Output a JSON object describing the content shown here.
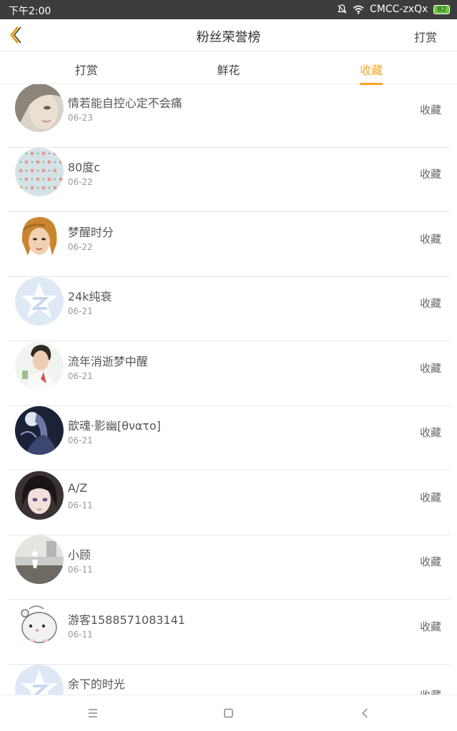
{
  "status": {
    "time": "下午2:00",
    "carrier": "CMCC-zxQx",
    "battery": "82"
  },
  "header": {
    "title": "粉丝荣誉榜",
    "action": "打赏"
  },
  "tabs": [
    {
      "label": "打赏",
      "active": false
    },
    {
      "label": "鲜花",
      "active": false
    },
    {
      "label": "收藏",
      "active": true
    }
  ],
  "accent_color": "#f5a623",
  "list": [
    {
      "name": "情若能自控心定不会痛",
      "date": "06-23",
      "action": "收藏",
      "avatar": "photo-avatar"
    },
    {
      "name": "80度c",
      "date": "06-22",
      "action": "收藏",
      "avatar": "pattern-avatar"
    },
    {
      "name": "梦醒时分",
      "date": "06-22",
      "action": "收藏",
      "avatar": "illustration-avatar"
    },
    {
      "name": "24k纯衰",
      "date": "06-21",
      "action": "收藏",
      "avatar": "default-avatar"
    },
    {
      "name": "流年消逝梦中醒",
      "date": "06-21",
      "action": "收藏",
      "avatar": "photo-avatar"
    },
    {
      "name": "歆魂·影幽[θνατο]",
      "date": "06-21",
      "action": "收藏",
      "avatar": "anime-avatar"
    },
    {
      "name": "A/Z",
      "date": "06-11",
      "action": "收藏",
      "avatar": "anime-avatar"
    },
    {
      "name": "小顾",
      "date": "06-11",
      "action": "收藏",
      "avatar": "photo-avatar"
    },
    {
      "name": "游客1588571083141",
      "date": "06-11",
      "action": "收藏",
      "avatar": "hamster-avatar"
    },
    {
      "name": "余下的时光",
      "date": "",
      "action": "收藏",
      "avatar": "default-avatar"
    }
  ],
  "navbar": {
    "icons": [
      "menu-icon",
      "home-icon",
      "back-icon"
    ]
  }
}
